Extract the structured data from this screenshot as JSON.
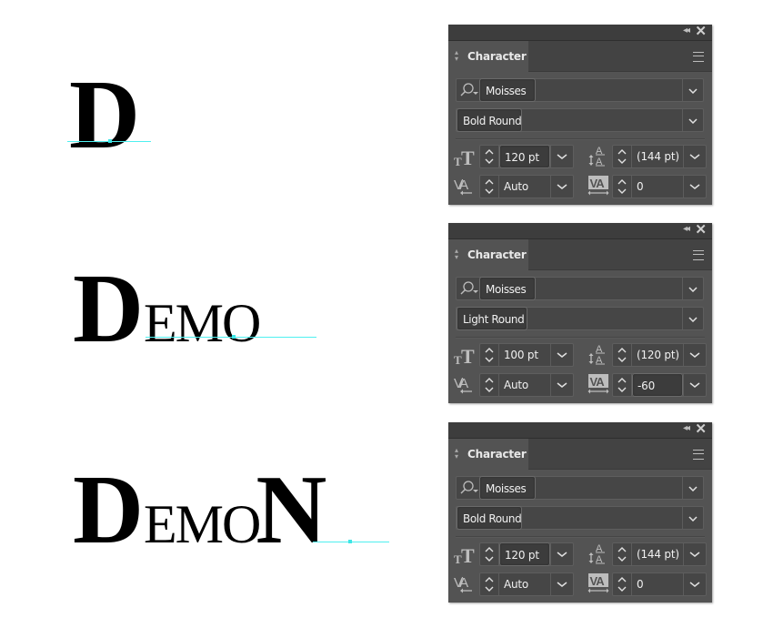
{
  "examples": [
    {
      "word": {
        "first": "D",
        "rest": ""
      },
      "panel": {
        "tab_label": "Character",
        "font_family": "Moisses",
        "font_style": "Bold Round",
        "font_size": "120 pt",
        "leading": "(144 pt)",
        "kerning": "Auto",
        "tracking": "0",
        "active_field": "font_size"
      }
    },
    {
      "word": {
        "first": "D",
        "rest": "EMO"
      },
      "panel": {
        "tab_label": "Character",
        "font_family": "Moisses",
        "font_style": "Light Round",
        "font_size": "100 pt",
        "leading": "(120 pt)",
        "kerning": "Auto",
        "tracking": "-60",
        "active_field": "tracking"
      }
    },
    {
      "word": {
        "first": "D",
        "rest": "EMO",
        "last": "N"
      },
      "panel": {
        "tab_label": "Character",
        "font_family": "Moisses",
        "font_style": "Bold Round",
        "font_size": "120 pt",
        "leading": "(144 pt)",
        "kerning": "Auto",
        "tracking": "0",
        "active_field": "font_size"
      }
    }
  ],
  "icons": {
    "collapse": "double-chevron-left-icon",
    "close": "close-icon",
    "menu": "hamburger-menu-icon",
    "search": "search-icon",
    "font_size": "font-size-icon",
    "leading": "leading-icon",
    "kerning": "kerning-icon",
    "tracking": "tracking-icon"
  },
  "colors": {
    "panel_bg": "#535353",
    "baseline_guide": "#4ff0f0"
  }
}
